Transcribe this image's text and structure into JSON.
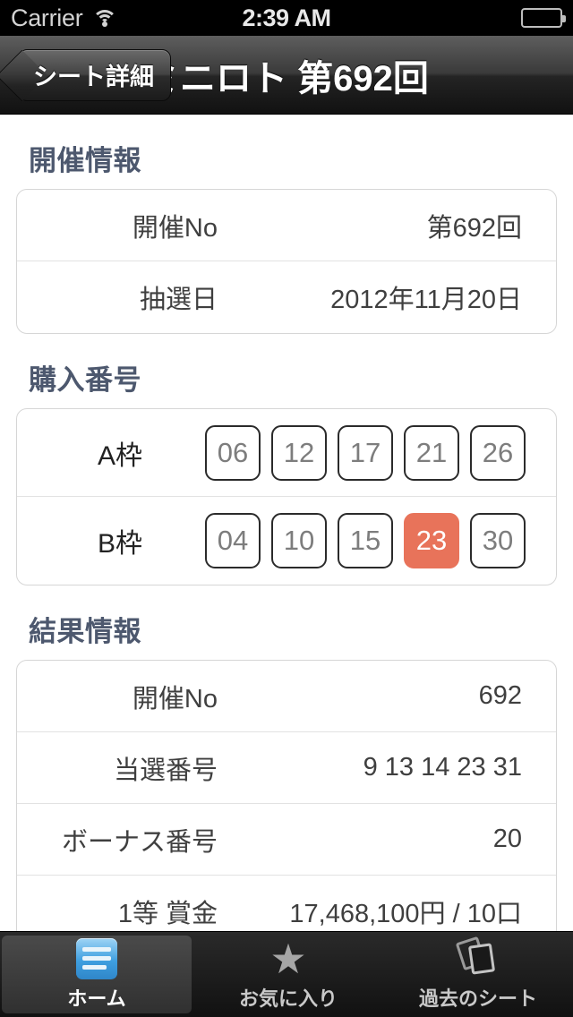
{
  "status_bar": {
    "carrier": "Carrier",
    "wifi_icon": "wifi-icon",
    "time": "2:39 AM",
    "battery_icon": "battery-icon"
  },
  "nav_bar": {
    "back_label": "シート詳細",
    "title": "ミニロト 第692回"
  },
  "sections": {
    "event_info": {
      "title": "開催情報",
      "rows": [
        {
          "label": "開催No",
          "value": "第692回"
        },
        {
          "label": "抽選日",
          "value": "2012年11月20日"
        }
      ]
    },
    "purchase_numbers": {
      "title": "購入番号",
      "rows": [
        {
          "label": "A枠",
          "numbers": [
            "06",
            "12",
            "17",
            "21",
            "26"
          ],
          "hits": []
        },
        {
          "label": "B枠",
          "numbers": [
            "04",
            "10",
            "15",
            "23",
            "30"
          ],
          "hits": [
            "23"
          ]
        }
      ]
    },
    "result_info": {
      "title": "結果情報",
      "rows": [
        {
          "label": "開催No",
          "value": "692"
        },
        {
          "label": "当選番号",
          "value": "9  13  14  23  31"
        },
        {
          "label": "ボーナス番号",
          "value": "20"
        },
        {
          "label": "1等 賞金",
          "value": "17,468,100円 / 10口"
        }
      ]
    }
  },
  "tab_bar": {
    "tabs": [
      {
        "label": "ホーム",
        "icon": "home-list-icon",
        "active": true
      },
      {
        "label": "お気に入り",
        "icon": "star-icon",
        "active": false
      },
      {
        "label": "過去のシート",
        "icon": "sheets-icon",
        "active": false
      }
    ]
  },
  "colors": {
    "highlight": "#e8735a",
    "section_title": "#4d586e",
    "tab_active_icon": "#3f9fe0"
  }
}
